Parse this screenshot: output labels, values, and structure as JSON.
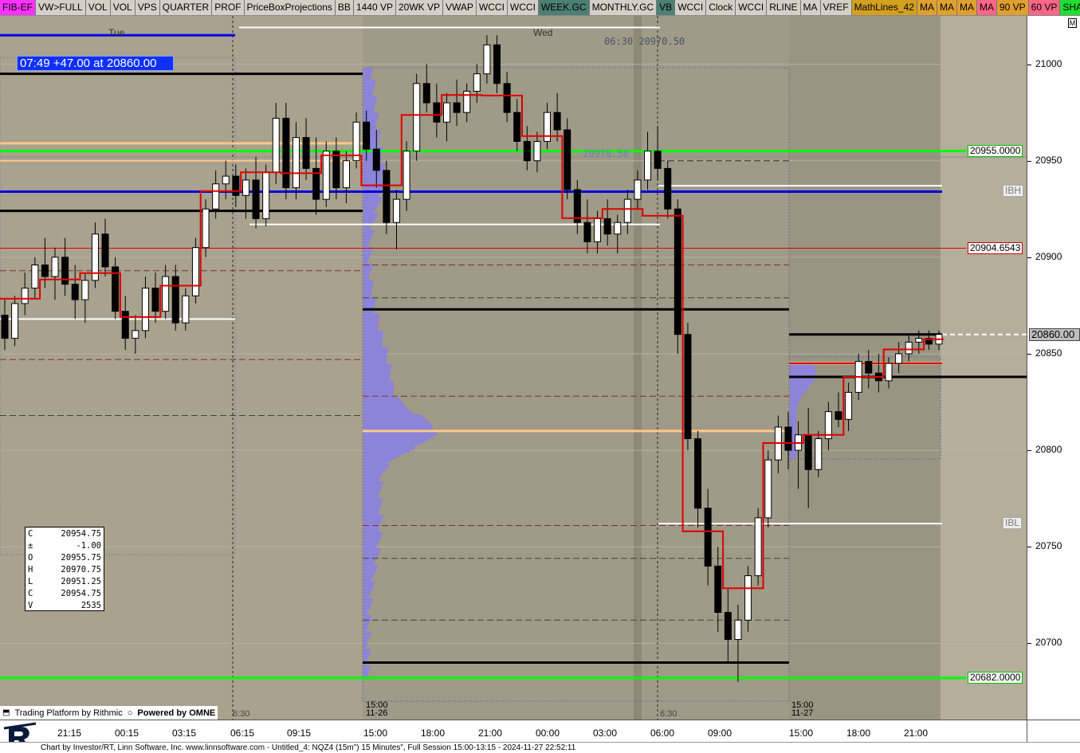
{
  "toolbar": [
    {
      "label": "FIB-EF",
      "bg": "#ff33ff"
    },
    {
      "label": "VW>FULL",
      "bg": "#d4d0c8"
    },
    {
      "label": "VOL",
      "bg": "#d4d0c8"
    },
    {
      "label": "VOL",
      "bg": "#d4d0c8"
    },
    {
      "label": "VPS",
      "bg": "#d4d0c8"
    },
    {
      "label": "QUARTER",
      "bg": "#d4d0c8"
    },
    {
      "label": "PROF",
      "bg": "#d4d0c8"
    },
    {
      "label": "PriceBoxProjections",
      "bg": "#d4d0c8"
    },
    {
      "label": "BB",
      "bg": "#d4d0c8"
    },
    {
      "label": "1440 VP",
      "bg": "#d4d0c8"
    },
    {
      "label": "20WK VP",
      "bg": "#d4d0c8"
    },
    {
      "label": "VWAP",
      "bg": "#d4d0c8"
    },
    {
      "label": "WCCI",
      "bg": "#d4d0c8"
    },
    {
      "label": "WCCI",
      "bg": "#d4d0c8"
    },
    {
      "label": "WEEK.GC",
      "bg": "#4c8070"
    },
    {
      "label": "MONTHLY.GC",
      "bg": "#d4d0c8"
    },
    {
      "label": "VB",
      "bg": "#4c8070"
    },
    {
      "label": "WCCI",
      "bg": "#d4d0c8"
    },
    {
      "label": "Clock",
      "bg": "#d4d0c8"
    },
    {
      "label": "WCCI",
      "bg": "#d4d0c8"
    },
    {
      "label": "RLINE",
      "bg": "#d4d0c8"
    },
    {
      "label": "MA",
      "bg": "#d4d0c8"
    },
    {
      "label": "VREF",
      "bg": "#d4d0c8"
    },
    {
      "label": "MathLines_42",
      "bg": "#d4a020"
    },
    {
      "label": "MA",
      "bg": "#e0a030"
    },
    {
      "label": "MA",
      "bg": "#e0a030"
    },
    {
      "label": "MA",
      "bg": "#e0a030"
    },
    {
      "label": "MA",
      "bg": "#ff6688"
    },
    {
      "label": "90 VP",
      "bg": "#e0a030"
    },
    {
      "label": "60 VP",
      "bg": "#ff6688"
    },
    {
      "label": "SHAPE",
      "bg": "#22dd33"
    },
    {
      "label": "SHA",
      "bg": "#22dd33"
    }
  ],
  "position_banner": "07:49  +47.00 at 20860.00",
  "day_labels": [
    {
      "text": "Tue",
      "time": "15:00-s0"
    },
    {
      "text": "Wed",
      "time": "15:00-s1"
    }
  ],
  "note_top": "06:30  20970.50",
  "note_mid": "20970.50",
  "ohlc": [
    {
      "k": "C",
      "v": "20954.75"
    },
    {
      "k": "±",
      "v": "-1.00"
    },
    {
      "k": "O",
      "v": "20955.75"
    },
    {
      "k": "H",
      "v": "20970.75"
    },
    {
      "k": "L",
      "v": "20951.25"
    },
    {
      "k": "C",
      "v": "20954.75"
    },
    {
      "k": "V",
      "v": "2535"
    }
  ],
  "price_tags": [
    {
      "text": "20955.0000",
      "price": 20955,
      "color": "#00c000"
    },
    {
      "text": "20904.6543",
      "price": 20904.6543,
      "color": "#d00000"
    },
    {
      "text": "20682.0000",
      "price": 20682,
      "color": "#00c000"
    }
  ],
  "ib_tags": [
    {
      "text": "IBH",
      "price": 20934
    },
    {
      "text": "IBL",
      "price": 20762
    }
  ],
  "last_price": {
    "text": "20860.00",
    "price": 20860
  },
  "m_button": "M",
  "session_labels": [
    {
      "line1": "15:00",
      "line2": "11-26"
    },
    {
      "line1": "6:30",
      "line2": ""
    },
    {
      "line1": "6:30",
      "line2": ""
    },
    {
      "line1": "15:00",
      "line2": "11-27"
    }
  ],
  "credits": {
    "rithmic": "Trading Platform by Rithmic",
    "omne": "Powered by OMNE"
  },
  "status_text": "Chart by Investor/RT, Linn Software, Inc. www.linnsoftware.com - Untitled_4: NQZ4 (15m\") 15 Minutes\", Full Session 15:00-13:15 - 2024-11-27 22:52:11",
  "chart_data": {
    "type": "candlestick",
    "symbol": "NQZ4",
    "interval": "15 Minutes",
    "y_axis": {
      "min": 20670,
      "max": 21025,
      "ticks": [
        21000,
        20950,
        20900,
        20850,
        20800,
        20750,
        20700
      ]
    },
    "x_axis": {
      "ticks": [
        "21:15",
        "00:15",
        "03:15",
        "06:15",
        "09:15",
        "15:00",
        "18:00",
        "21:00",
        "00:00",
        "03:00",
        "06:00",
        "09:00",
        "15:00",
        "18:00",
        "21:00"
      ]
    },
    "day_labels": [
      "Tue",
      "Wed"
    ],
    "horizontal_levels": [
      {
        "price": 20955,
        "color": "#00ff00",
        "label": "20955.0000"
      },
      {
        "price": 20682,
        "color": "#00ff00",
        "label": "20682.0000"
      },
      {
        "price": 20904.6543,
        "color": "#dd0000",
        "label": "20904.6543"
      },
      {
        "price": 20934,
        "color": "#ffffff",
        "label": "IBH"
      },
      {
        "price": 20762,
        "color": "#ffffff",
        "label": "IBL"
      },
      {
        "price": 20860,
        "color": "#000000",
        "label": "20860.00"
      }
    ],
    "series": [
      {
        "x": 0,
        "o": 20870,
        "h": 20878,
        "l": 20852,
        "c": 20858
      },
      {
        "x": 1,
        "o": 20858,
        "h": 20880,
        "l": 20854,
        "c": 20876
      },
      {
        "x": 2,
        "o": 20876,
        "h": 20892,
        "l": 20870,
        "c": 20884
      },
      {
        "x": 3,
        "o": 20884,
        "h": 20900,
        "l": 20878,
        "c": 20896
      },
      {
        "x": 4,
        "o": 20896,
        "h": 20910,
        "l": 20884,
        "c": 20890
      },
      {
        "x": 5,
        "o": 20890,
        "h": 20905,
        "l": 20878,
        "c": 20900
      },
      {
        "x": 6,
        "o": 20900,
        "h": 20910,
        "l": 20880,
        "c": 20886
      },
      {
        "x": 7,
        "o": 20886,
        "h": 20896,
        "l": 20868,
        "c": 20878
      },
      {
        "x": 8,
        "o": 20878,
        "h": 20892,
        "l": 20866,
        "c": 20888
      },
      {
        "x": 9,
        "o": 20888,
        "h": 20918,
        "l": 20884,
        "c": 20912
      },
      {
        "x": 10,
        "o": 20912,
        "h": 20920,
        "l": 20890,
        "c": 20895
      },
      {
        "x": 11,
        "o": 20895,
        "h": 20900,
        "l": 20868,
        "c": 20872
      },
      {
        "x": 12,
        "o": 20872,
        "h": 20880,
        "l": 20852,
        "c": 20858
      },
      {
        "x": 13,
        "o": 20858,
        "h": 20870,
        "l": 20850,
        "c": 20862
      },
      {
        "x": 14,
        "o": 20862,
        "h": 20890,
        "l": 20858,
        "c": 20884
      },
      {
        "x": 15,
        "o": 20884,
        "h": 20892,
        "l": 20866,
        "c": 20872
      },
      {
        "x": 16,
        "o": 20872,
        "h": 20896,
        "l": 20868,
        "c": 20890
      },
      {
        "x": 17,
        "o": 20890,
        "h": 20896,
        "l": 20862,
        "c": 20866
      },
      {
        "x": 18,
        "o": 20866,
        "h": 20884,
        "l": 20862,
        "c": 20880
      },
      {
        "x": 19,
        "o": 20880,
        "h": 20910,
        "l": 20876,
        "c": 20905
      },
      {
        "x": 20,
        "o": 20905,
        "h": 20930,
        "l": 20900,
        "c": 20925
      },
      {
        "x": 21,
        "o": 20925,
        "h": 20945,
        "l": 20920,
        "c": 20938
      },
      {
        "x": 22,
        "o": 20938,
        "h": 20950,
        "l": 20930,
        "c": 20942
      },
      {
        "x": 23,
        "o": 20942,
        "h": 20948,
        "l": 20926,
        "c": 20932
      },
      {
        "x": 24,
        "o": 20932,
        "h": 20946,
        "l": 20920,
        "c": 20940
      },
      {
        "x": 25,
        "o": 20940,
        "h": 20952,
        "l": 20915,
        "c": 20920
      },
      {
        "x": 26,
        "o": 20920,
        "h": 20948,
        "l": 20916,
        "c": 20944
      },
      {
        "x": 27,
        "o": 20944,
        "h": 20980,
        "l": 20938,
        "c": 20972
      },
      {
        "x": 28,
        "o": 20972,
        "h": 20980,
        "l": 20930,
        "c": 20936
      },
      {
        "x": 29,
        "o": 20936,
        "h": 20970,
        "l": 20930,
        "c": 20962
      },
      {
        "x": 30,
        "o": 20962,
        "h": 20972,
        "l": 20940,
        "c": 20946
      },
      {
        "x": 31,
        "o": 20946,
        "h": 20962,
        "l": 20922,
        "c": 20930
      },
      {
        "x": 32,
        "o": 20930,
        "h": 20960,
        "l": 20926,
        "c": 20955
      },
      {
        "x": 33,
        "o": 20955,
        "h": 20962,
        "l": 20930,
        "c": 20936
      },
      {
        "x": 34,
        "o": 20936,
        "h": 20955,
        "l": 20928,
        "c": 20950
      },
      {
        "x": 35,
        "o": 20950,
        "h": 20975,
        "l": 20946,
        "c": 20970
      },
      {
        "x": 36,
        "o": 20970,
        "h": 20976,
        "l": 20950,
        "c": 20956
      },
      {
        "x": 37,
        "o": 20956,
        "h": 20966,
        "l": 20936,
        "c": 20945
      },
      {
        "x": 38,
        "o": 20945,
        "h": 20950,
        "l": 20912,
        "c": 20918
      },
      {
        "x": 39,
        "o": 20918,
        "h": 20935,
        "l": 20904,
        "c": 20930
      },
      {
        "x": 40,
        "o": 20930,
        "h": 20960,
        "l": 20924,
        "c": 20955
      },
      {
        "x": 41,
        "o": 20955,
        "h": 20995,
        "l": 20950,
        "c": 20990
      },
      {
        "x": 42,
        "o": 20990,
        "h": 21000,
        "l": 20975,
        "c": 20980
      },
      {
        "x": 43,
        "o": 20980,
        "h": 20990,
        "l": 20962,
        "c": 20970
      },
      {
        "x": 44,
        "o": 20970,
        "h": 20985,
        "l": 20960,
        "c": 20980
      },
      {
        "x": 45,
        "o": 20980,
        "h": 20992,
        "l": 20968,
        "c": 20975
      },
      {
        "x": 46,
        "o": 20975,
        "h": 20990,
        "l": 20970,
        "c": 20986
      },
      {
        "x": 47,
        "o": 20986,
        "h": 21000,
        "l": 20980,
        "c": 20995
      },
      {
        "x": 48,
        "o": 20995,
        "h": 21015,
        "l": 20990,
        "c": 21010
      },
      {
        "x": 49,
        "o": 21010,
        "h": 21015,
        "l": 20985,
        "c": 20990
      },
      {
        "x": 50,
        "o": 20990,
        "h": 20996,
        "l": 20970,
        "c": 20975
      },
      {
        "x": 51,
        "o": 20975,
        "h": 20982,
        "l": 20955,
        "c": 20960
      },
      {
        "x": 52,
        "o": 20960,
        "h": 20968,
        "l": 20945,
        "c": 20950
      },
      {
        "x": 53,
        "o": 20950,
        "h": 20965,
        "l": 20944,
        "c": 20960
      },
      {
        "x": 54,
        "o": 20960,
        "h": 20980,
        "l": 20956,
        "c": 20975
      },
      {
        "x": 55,
        "o": 20975,
        "h": 20985,
        "l": 20960,
        "c": 20966
      },
      {
        "x": 56,
        "o": 20966,
        "h": 20972,
        "l": 20930,
        "c": 20935
      },
      {
        "x": 57,
        "o": 20935,
        "h": 20940,
        "l": 20912,
        "c": 20918
      },
      {
        "x": 58,
        "o": 20918,
        "h": 20930,
        "l": 20902,
        "c": 20908
      },
      {
        "x": 59,
        "o": 20908,
        "h": 20924,
        "l": 20902,
        "c": 20920
      },
      {
        "x": 60,
        "o": 20920,
        "h": 20930,
        "l": 20906,
        "c": 20912
      },
      {
        "x": 61,
        "o": 20912,
        "h": 20922,
        "l": 20902,
        "c": 20918
      },
      {
        "x": 62,
        "o": 20918,
        "h": 20935,
        "l": 20912,
        "c": 20930
      },
      {
        "x": 63,
        "o": 20930,
        "h": 20945,
        "l": 20925,
        "c": 20940
      },
      {
        "x": 64,
        "o": 20940,
        "h": 20965,
        "l": 20935,
        "c": 20955
      },
      {
        "x": 65,
        "o": 20955,
        "h": 20968,
        "l": 20940,
        "c": 20946
      },
      {
        "x": 66,
        "o": 20946,
        "h": 20950,
        "l": 20920,
        "c": 20925
      },
      {
        "x": 67,
        "o": 20925,
        "h": 20930,
        "l": 20850,
        "c": 20860
      },
      {
        "x": 68,
        "o": 20860,
        "h": 20866,
        "l": 20800,
        "c": 20806
      },
      {
        "x": 69,
        "o": 20806,
        "h": 20810,
        "l": 20760,
        "c": 20770
      },
      {
        "x": 70,
        "o": 20770,
        "h": 20780,
        "l": 20730,
        "c": 20740
      },
      {
        "x": 71,
        "o": 20740,
        "h": 20750,
        "l": 20706,
        "c": 20716
      },
      {
        "x": 72,
        "o": 20716,
        "h": 20728,
        "l": 20690,
        "c": 20702
      },
      {
        "x": 73,
        "o": 20702,
        "h": 20720,
        "l": 20680,
        "c": 20712
      },
      {
        "x": 74,
        "o": 20712,
        "h": 20740,
        "l": 20706,
        "c": 20735
      },
      {
        "x": 75,
        "o": 20735,
        "h": 20770,
        "l": 20730,
        "c": 20765
      },
      {
        "x": 76,
        "o": 20765,
        "h": 20800,
        "l": 20760,
        "c": 20795
      },
      {
        "x": 77,
        "o": 20795,
        "h": 20818,
        "l": 20788,
        "c": 20812
      },
      {
        "x": 78,
        "o": 20812,
        "h": 20820,
        "l": 20790,
        "c": 20800
      },
      {
        "x": 79,
        "o": 20800,
        "h": 20815,
        "l": 20780,
        "c": 20808
      },
      {
        "x": 80,
        "o": 20808,
        "h": 20822,
        "l": 20770,
        "c": 20790
      },
      {
        "x": 81,
        "o": 20790,
        "h": 20810,
        "l": 20786,
        "c": 20806
      },
      {
        "x": 82,
        "o": 20806,
        "h": 20825,
        "l": 20800,
        "c": 20820
      },
      {
        "x": 83,
        "o": 20820,
        "h": 20830,
        "l": 20812,
        "c": 20816
      },
      {
        "x": 84,
        "o": 20816,
        "h": 20835,
        "l": 20810,
        "c": 20830
      },
      {
        "x": 85,
        "o": 20830,
        "h": 20850,
        "l": 20826,
        "c": 20846
      },
      {
        "x": 86,
        "o": 20846,
        "h": 20852,
        "l": 20832,
        "c": 20840
      },
      {
        "x": 87,
        "o": 20840,
        "h": 20850,
        "l": 20830,
        "c": 20836
      },
      {
        "x": 88,
        "o": 20836,
        "h": 20848,
        "l": 20832,
        "c": 20845
      },
      {
        "x": 89,
        "o": 20845,
        "h": 20856,
        "l": 20840,
        "c": 20850
      },
      {
        "x": 90,
        "o": 20850,
        "h": 20860,
        "l": 20846,
        "c": 20856
      },
      {
        "x": 91,
        "o": 20856,
        "h": 20862,
        "l": 20850,
        "c": 20858
      },
      {
        "x": 92,
        "o": 20858,
        "h": 20862,
        "l": 20852,
        "c": 20855
      },
      {
        "x": 93,
        "o": 20855,
        "h": 20862,
        "l": 20852,
        "c": 20860
      }
    ]
  }
}
